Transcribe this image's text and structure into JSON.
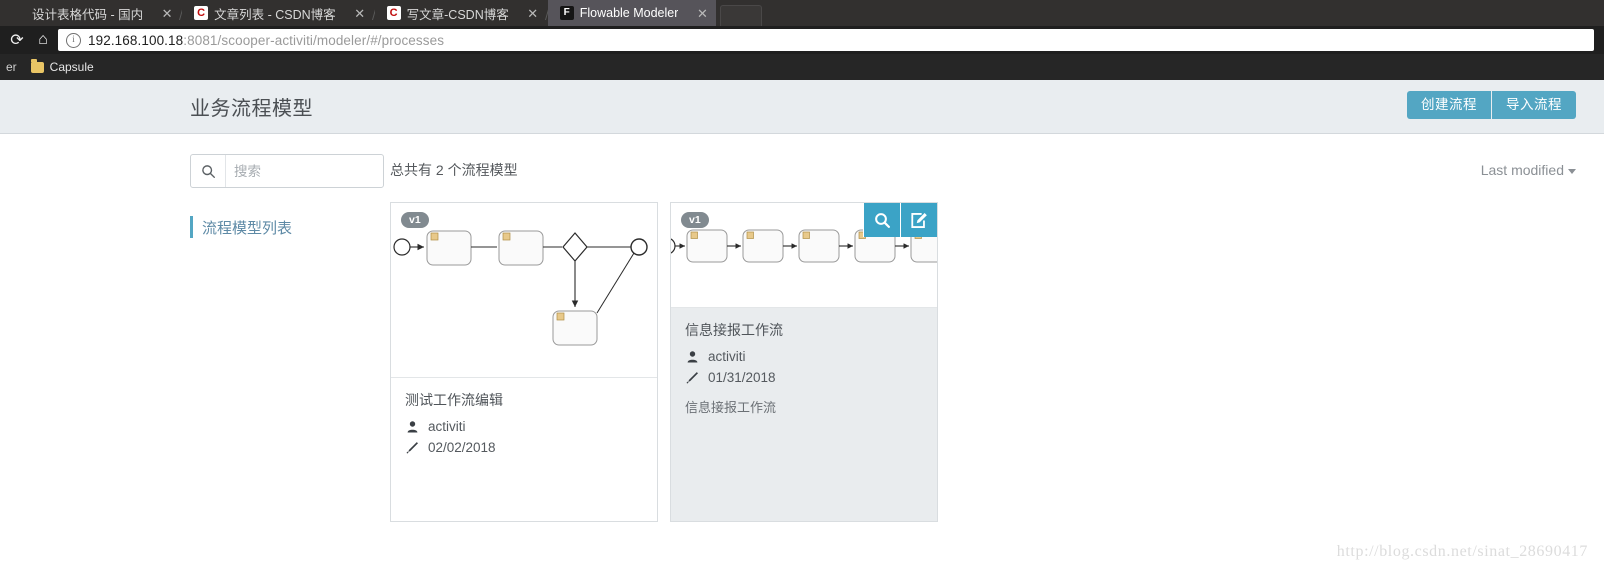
{
  "browser": {
    "tabs": [
      {
        "title": "设计表格代码 - 国内",
        "favicon": "blank-favicon",
        "active": false
      },
      {
        "title": "文章列表 - CSDN博客",
        "favicon": "csdn-favicon",
        "active": false
      },
      {
        "title": "写文章-CSDN博客",
        "favicon": "csdn-favicon",
        "active": false
      },
      {
        "title": "Flowable Modeler",
        "favicon": "flowable-favicon",
        "active": true
      }
    ],
    "tab_close_glyph": "✕",
    "reload_icon": "reload-icon",
    "home_icon": "home-icon",
    "reload_glyph": "⟳",
    "home_glyph": "⌂",
    "site_info_glyph": "i",
    "url_host": "192.168.100.18",
    "url_path": ":8081/scooper-activiti/modeler/#/processes",
    "bookmarks": [
      {
        "label": "er",
        "icon": "none"
      },
      {
        "label": "Capsule",
        "icon": "folder-icon"
      }
    ]
  },
  "app": {
    "title": "业务流程模型",
    "header_buttons": [
      {
        "label": "创建流程",
        "name": "create-process-button"
      },
      {
        "label": "导入流程",
        "name": "import-process-button"
      }
    ],
    "accent_color": "#53a6c3",
    "search": {
      "placeholder": "搜索",
      "value": "",
      "icon": "search-icon"
    },
    "sidebar": {
      "items": [
        {
          "label": "流程模型列表",
          "active": true
        }
      ]
    },
    "total_text": "总共有 2 个流程模型",
    "sort": {
      "label": "Last modified",
      "caret_icon": "chevron-down-icon"
    },
    "cards": [
      {
        "version": "v1",
        "name": "测试工作流编辑",
        "author": "activiti",
        "author_icon": "user-icon",
        "date": "02/02/2018",
        "date_icon": "pencil-icon",
        "description": "",
        "hovered": false
      },
      {
        "version": "v1",
        "name": "信息接报工作流",
        "author": "activiti",
        "author_icon": "user-icon",
        "date": "01/31/2018",
        "date_icon": "pencil-icon",
        "description": "信息接报工作流",
        "hovered": true,
        "actions": [
          {
            "name": "view-process-button",
            "icon": "magnifier-icon"
          },
          {
            "name": "edit-process-button",
            "icon": "edit-square-icon"
          }
        ]
      }
    ]
  },
  "watermark": "http://blog.csdn.net/sinat_28690417"
}
